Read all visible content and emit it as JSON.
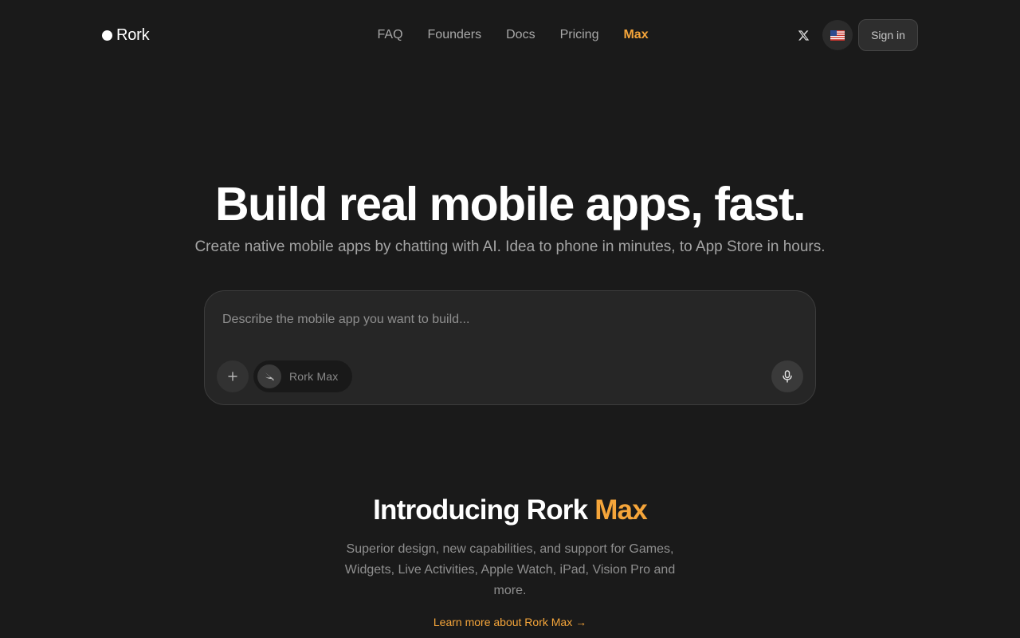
{
  "brand": {
    "name": "Rork",
    "accent_color": "#f5a53a",
    "background_color": "#1a1a1a"
  },
  "nav": {
    "items": [
      {
        "label": "FAQ"
      },
      {
        "label": "Founders"
      },
      {
        "label": "Docs"
      },
      {
        "label": "Pricing"
      },
      {
        "label": "Max",
        "active": true
      }
    ]
  },
  "header_actions": {
    "x_icon": "x-logo-icon",
    "language_flag": "🇺🇸",
    "sign_in_label": "Sign in"
  },
  "hero": {
    "title": "Build real mobile apps, fast.",
    "subtitle": "Create native mobile apps by chatting with AI. Idea to phone in minutes, to App Store in hours."
  },
  "prompt": {
    "placeholder": "Describe the mobile app you want to build...",
    "value": "",
    "add_icon": "plus-icon",
    "model_icon": "swift-icon",
    "model_label": "Rork Max",
    "mic_icon": "microphone-icon"
  },
  "intro": {
    "title_prefix": "Introducing Rork ",
    "title_accent": "Max",
    "description": "Superior design, new capabilities, and support for Games, Widgets, Live Activities, Apple Watch, iPad, Vision Pro and more.",
    "learn_more_label": "Learn more about Rork Max →"
  }
}
